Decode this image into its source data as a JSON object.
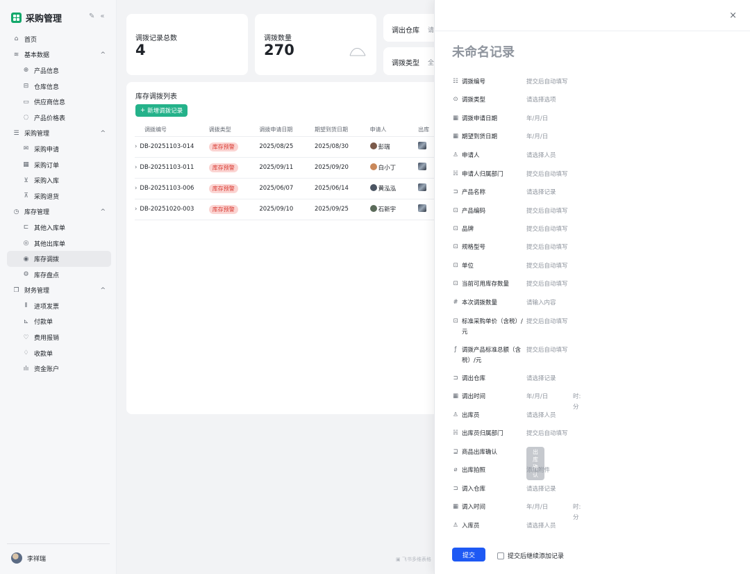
{
  "sidebar": {
    "brand": "采购管理",
    "items": [
      {
        "label": "首页",
        "icon": "home-icon",
        "glyph": "⌂",
        "level": 0
      },
      {
        "label": "基本数据",
        "icon": "layers-icon",
        "glyph": "≋",
        "level": 0,
        "chevron": "^"
      },
      {
        "label": "产品信息",
        "icon": "globe-icon",
        "glyph": "⊕",
        "level": 1
      },
      {
        "label": "仓库信息",
        "icon": "warehouse-icon",
        "glyph": "⊟",
        "level": 1
      },
      {
        "label": "供应商信息",
        "icon": "monitor-icon",
        "glyph": "▭",
        "level": 1
      },
      {
        "label": "产品价格表",
        "icon": "price-icon",
        "glyph": "◌",
        "level": 1
      },
      {
        "label": "采购管理",
        "icon": "database-icon",
        "glyph": "☰",
        "level": 0,
        "chevron": "^"
      },
      {
        "label": "采购申请",
        "icon": "mail-icon",
        "glyph": "✉",
        "level": 1
      },
      {
        "label": "采购订单",
        "icon": "calendar-icon",
        "glyph": "▦",
        "level": 1
      },
      {
        "label": "采购入库",
        "icon": "inbox-icon",
        "glyph": "⊻",
        "level": 1
      },
      {
        "label": "采购退货",
        "icon": "return-icon",
        "glyph": "⊼",
        "level": 1
      },
      {
        "label": "库存管理",
        "icon": "clock-icon",
        "glyph": "◷",
        "level": 0,
        "chevron": "^"
      },
      {
        "label": "其他入库单",
        "icon": "stock-in-icon",
        "glyph": "⊏",
        "level": 1
      },
      {
        "label": "其他出库单",
        "icon": "stock-out-icon",
        "glyph": "◎",
        "level": 1
      },
      {
        "label": "库存调拨",
        "icon": "transfer-icon",
        "glyph": "◉",
        "level": 1,
        "active": true
      },
      {
        "label": "库存盘点",
        "icon": "gear-icon",
        "glyph": "⚙",
        "level": 1
      },
      {
        "label": "财务管理",
        "icon": "copy-icon",
        "glyph": "❐",
        "level": 0,
        "chevron": "^"
      },
      {
        "label": "进项发票",
        "icon": "barcode-icon",
        "glyph": "⦀",
        "level": 1
      },
      {
        "label": "付款单",
        "icon": "chart-icon",
        "glyph": "⊾",
        "level": 1
      },
      {
        "label": "费用报销",
        "icon": "trophy-icon",
        "glyph": "♡",
        "level": 1
      },
      {
        "label": "收款单",
        "icon": "bulb-icon",
        "glyph": "♢",
        "level": 1
      },
      {
        "label": "资金账户",
        "icon": "bar-chart-icon",
        "glyph": "ılı",
        "level": 1
      }
    ],
    "user": "李祥瑞"
  },
  "stats": [
    {
      "label": "调拨记录总数",
      "value": "4"
    },
    {
      "label": "调拨数量",
      "value": "270"
    }
  ],
  "filters": [
    {
      "label": "调出仓库",
      "value": "请"
    },
    {
      "label": "调拨类型",
      "value": "全"
    }
  ],
  "list": {
    "title": "库存调拨列表",
    "add_label": "新增调拨记录",
    "columns": [
      "调拨编号",
      "调拨类型",
      "调拨申请日期",
      "期望到货日期",
      "申请人",
      "出库"
    ],
    "rows": [
      {
        "id": "DB-20251103-014",
        "type": "库存预警",
        "apply_date": "2025/08/25",
        "expect_date": "2025/08/30",
        "applicant": "彭瑞",
        "avatar_color": "#7a5a4a"
      },
      {
        "id": "DB-20251103-011",
        "type": "库存预警",
        "apply_date": "2025/09/11",
        "expect_date": "2025/09/20",
        "applicant": "白小丁",
        "avatar_color": "#c9885a"
      },
      {
        "id": "DB-20251103-006",
        "type": "库存预警",
        "apply_date": "2025/06/07",
        "expect_date": "2025/06/14",
        "applicant": "黄泓泓",
        "avatar_color": "#4b5563"
      },
      {
        "id": "DB-20251020-003",
        "type": "库存预警",
        "apply_date": "2025/09/10",
        "expect_date": "2025/09/25",
        "applicant": "石新宇",
        "avatar_color": "#5b6b5a"
      }
    ]
  },
  "watermark": "飞书多维表格",
  "drawer": {
    "close": "×",
    "title": "未命名记录",
    "fields": [
      {
        "icon": "list-number-icon",
        "glyph": "☷",
        "label": "调拨编号",
        "value": "提交后自动填写"
      },
      {
        "icon": "select-icon",
        "glyph": "⊙",
        "label": "调拨类型",
        "value": "请选择选项"
      },
      {
        "icon": "calendar-icon",
        "glyph": "▦",
        "label": "调拨申请日期",
        "value": "年/月/日"
      },
      {
        "icon": "calendar-icon",
        "glyph": "▦",
        "label": "期望到货日期",
        "value": "年/月/日"
      },
      {
        "icon": "person-icon",
        "glyph": "♙",
        "label": "申请人",
        "value": "请选择人员"
      },
      {
        "icon": "lookup-icon",
        "glyph": "☵",
        "label": "申请人归属部门",
        "value": "提交后自动填写"
      },
      {
        "icon": "link-icon",
        "glyph": "⊐",
        "label": "产品名称",
        "value": "请选择记录"
      },
      {
        "icon": "lookup-icon",
        "glyph": "⊡",
        "label": "产品编码",
        "value": "提交后自动填写"
      },
      {
        "icon": "lookup-icon",
        "glyph": "⊡",
        "label": "品牌",
        "value": "提交后自动填写"
      },
      {
        "icon": "lookup-icon",
        "glyph": "⊡",
        "label": "规格型号",
        "value": "提交后自动填写"
      },
      {
        "icon": "lookup-icon",
        "glyph": "⊡",
        "label": "单位",
        "value": "提交后自动填写"
      },
      {
        "icon": "lookup-icon",
        "glyph": "⊡",
        "label": "当前可用库存数量",
        "value": "提交后自动填写"
      },
      {
        "icon": "number-icon",
        "glyph": "#",
        "label": "本次调拨数量",
        "value": "请输入内容"
      },
      {
        "icon": "lookup-icon",
        "glyph": "⊡",
        "label": "标准采购单价（含税）/元",
        "value": "提交后自动填写"
      },
      {
        "icon": "formula-icon",
        "glyph": "ƒ",
        "label": "调拨产品标准总额（含税）/元",
        "value": "提交后自动填写"
      },
      {
        "icon": "link-icon",
        "glyph": "⊐",
        "label": "调出仓库",
        "value": "请选择记录"
      },
      {
        "icon": "calendar-icon",
        "glyph": "▦",
        "label": "调出时间",
        "value": "年/月/日",
        "value2": "时:分"
      },
      {
        "icon": "person-icon",
        "glyph": "♙",
        "label": "出库员",
        "value": "请选择人员"
      },
      {
        "icon": "lookup-icon",
        "glyph": "☵",
        "label": "出库员归属部门",
        "value": "提交后自动填写"
      },
      {
        "icon": "button-icon",
        "glyph": "⊒",
        "label": "商品出库确认",
        "button": "出库确认"
      },
      {
        "icon": "attachment-icon",
        "glyph": "⌀",
        "label": "出库拍照",
        "value": "添加附件"
      },
      {
        "icon": "link-icon",
        "glyph": "⊐",
        "label": "调入仓库",
        "value": "请选择记录"
      },
      {
        "icon": "calendar-icon",
        "glyph": "▦",
        "label": "调入时间",
        "value": "年/月/日",
        "value2": "时:分"
      },
      {
        "icon": "person-icon",
        "glyph": "♙",
        "label": "入库员",
        "value": "请选择人员"
      }
    ],
    "submit": "提交",
    "continue_label": "提交后继续添加记录"
  }
}
